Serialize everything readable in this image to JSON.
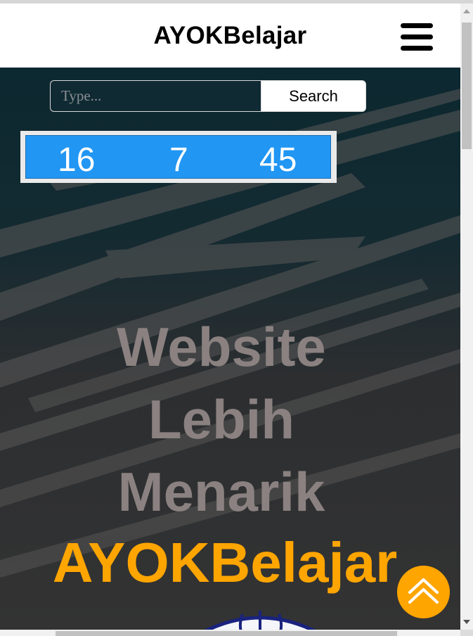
{
  "navbar": {
    "brand": "AYOKBelajar",
    "menu_icon": "hamburger-menu-icon"
  },
  "search": {
    "placeholder": "Type...",
    "button_label": "Search"
  },
  "clock": {
    "hours": "16",
    "minutes": "7",
    "seconds": "45",
    "background": "#2196f3"
  },
  "hero": {
    "line1": "Website",
    "line2": "Lebih",
    "line3": "Menarik",
    "brand": "AYOKBelajar",
    "brand_color": "#ffa500",
    "headline_color": "#8a8180"
  },
  "scroll_top": {
    "icon": "double-chevron-up-icon",
    "color": "#ffa500"
  }
}
